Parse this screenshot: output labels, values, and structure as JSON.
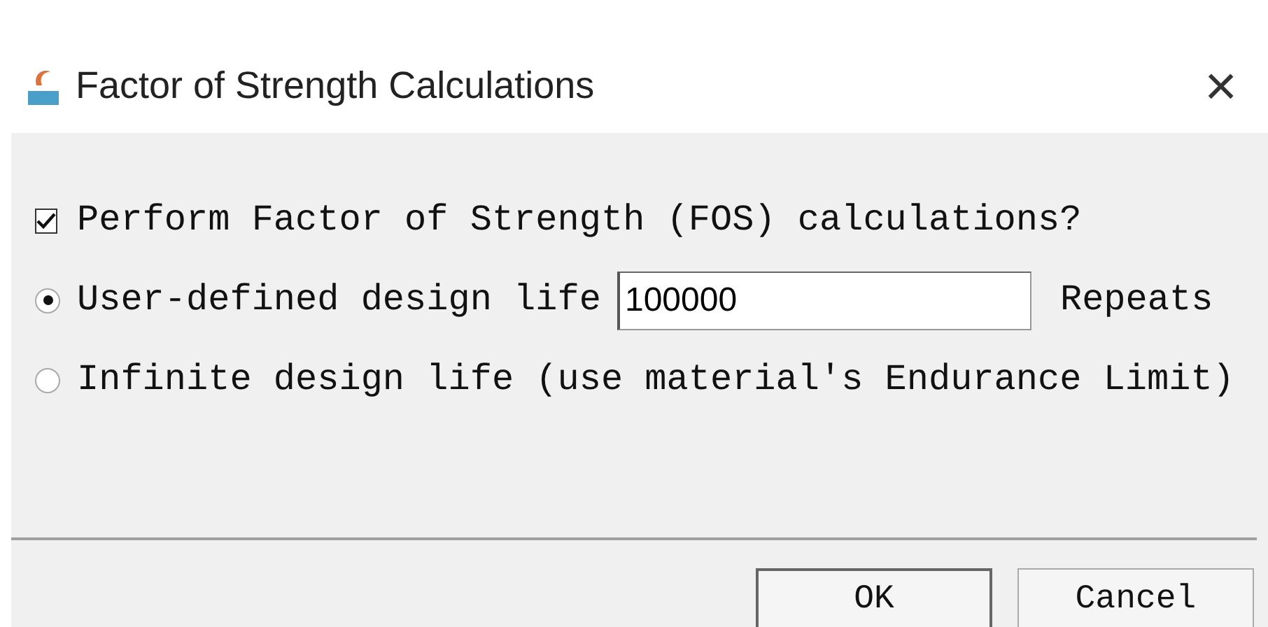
{
  "window": {
    "title": "Factor of Strength Calculations",
    "close": "×"
  },
  "options": [
    {
      "kind": "checkbox",
      "label": "Perform Factor of Strength (FOS) calculations?",
      "checked": true
    },
    {
      "kind": "radio",
      "label": "User-defined design life",
      "selected": true,
      "value": "100000",
      "unit": "Repeats"
    },
    {
      "kind": "radio",
      "label": "Infinite design life (use material's Endurance Limit)",
      "selected": false
    }
  ],
  "buttons": [
    {
      "label": "OK",
      "default": true
    },
    {
      "label": "Cancel",
      "default": false
    }
  ]
}
